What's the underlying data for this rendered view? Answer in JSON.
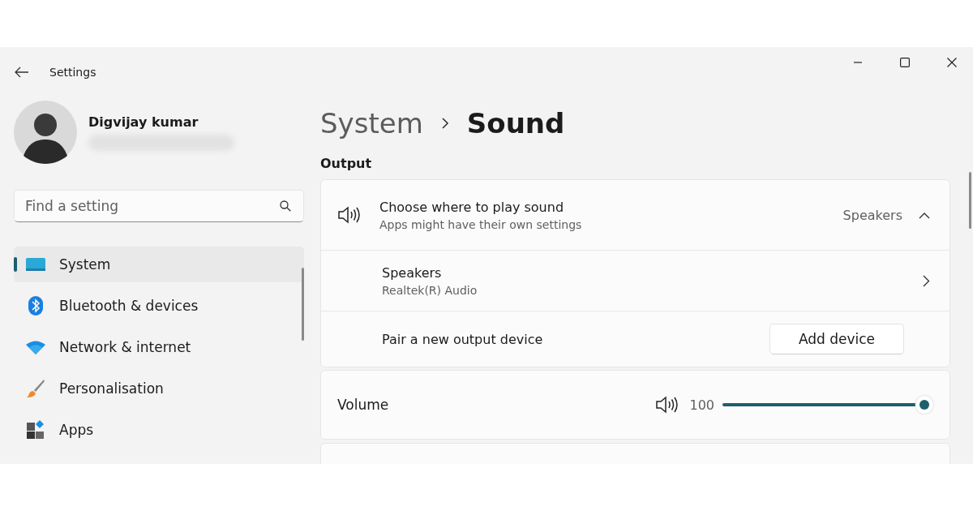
{
  "window": {
    "title": "Settings"
  },
  "user": {
    "name": "Digvijay kumar"
  },
  "search": {
    "placeholder": "Find a setting"
  },
  "sidebar": {
    "items": [
      {
        "label": "System",
        "selected": true,
        "kind": "system"
      },
      {
        "label": "Bluetooth & devices",
        "selected": false,
        "kind": "bluetooth"
      },
      {
        "label": "Network & internet",
        "selected": false,
        "kind": "network"
      },
      {
        "label": "Personalisation",
        "selected": false,
        "kind": "brush"
      },
      {
        "label": "Apps",
        "selected": false,
        "kind": "apps"
      }
    ]
  },
  "breadcrumb": {
    "parent": "System",
    "current": "Sound"
  },
  "section_title": "Output",
  "output_card": {
    "header": {
      "title": "Choose where to play sound",
      "subtitle": "Apps might have their own settings",
      "value": "Speakers",
      "expanded": true
    },
    "device": {
      "name": "Speakers",
      "description": "Realtek(R) Audio"
    },
    "pair": {
      "label": "Pair a new output device",
      "button": "Add device"
    }
  },
  "volume": {
    "label": "Volume",
    "reading": "100",
    "level": 1.0
  }
}
